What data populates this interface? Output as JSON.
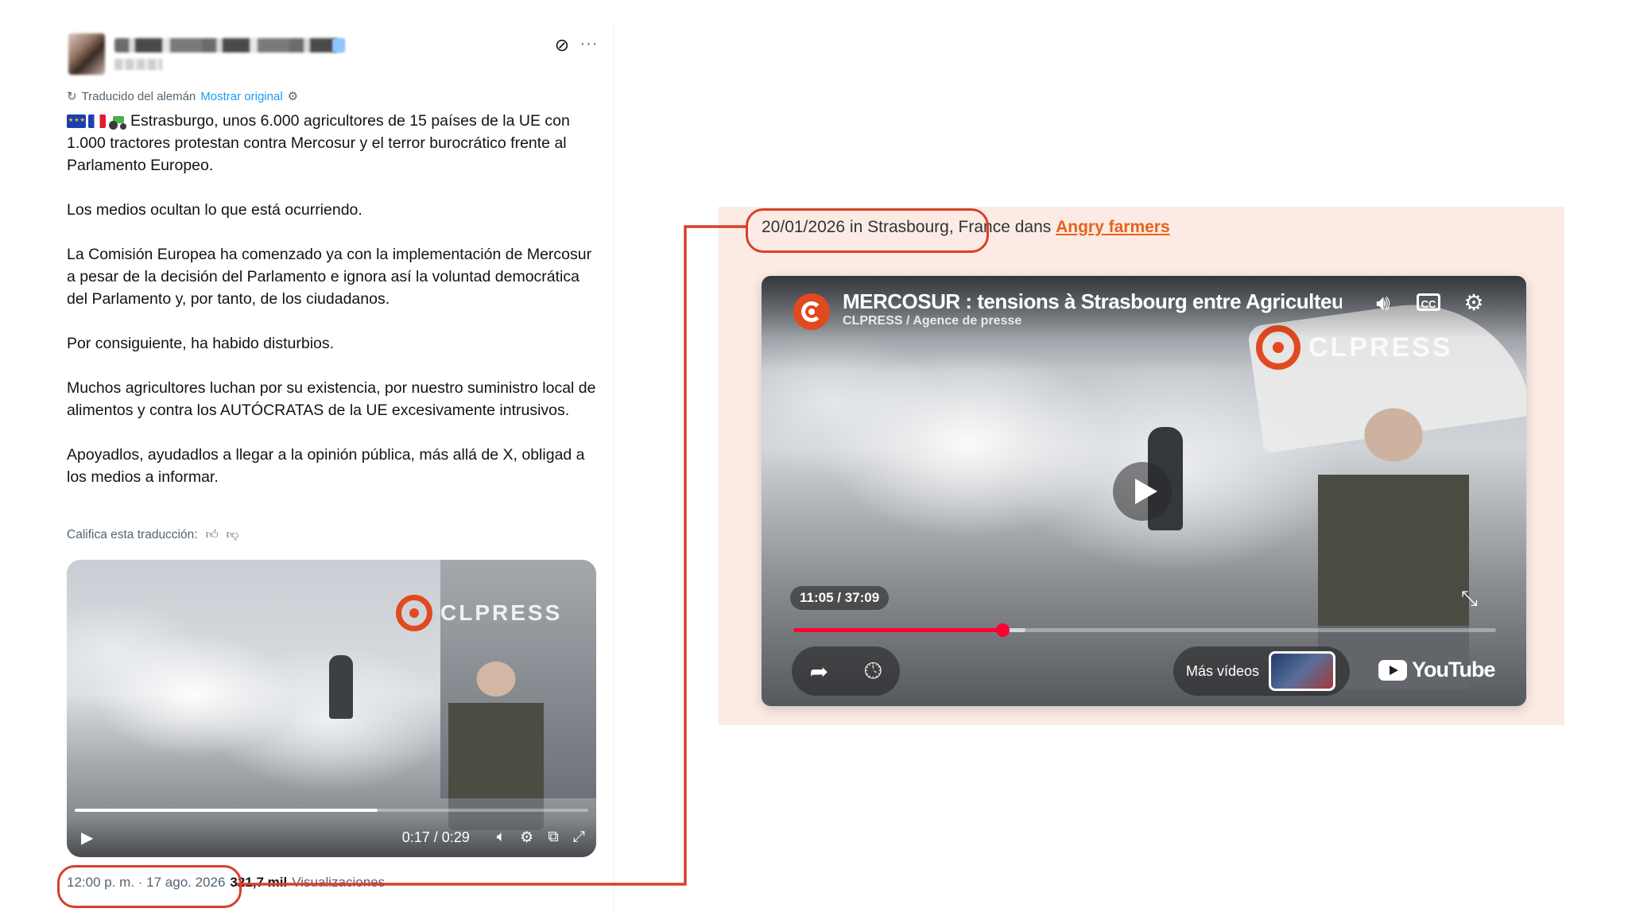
{
  "tweet": {
    "translated_label": "Traducido del alemán",
    "show_original_label": "Mostrar original",
    "paragraphs": [
      "Estrasburgo, unos 6.000 agricultores de 15 países de la UE con 1.000 tractores protestan contra Mercosur y el terror burocrático frente al Parlamento Europeo.",
      "Los medios ocultan lo que está ocurriendo.",
      "La Comisión Europea ha comenzado ya con la implementación de Mercosur a pesar de la decisión del Parlamento e ignora así la voluntad democrática del Parlamento y, por tanto, de los ciudadanos.",
      "Por consiguiente, ha habido disturbios.",
      "Muchos agricultores luchan por su existencia, por nuestro suministro local de alimentos y contra los AUTÓCRATAS de la UE excesivamente intrusivos.",
      "Apoyadlos, ayudadlos a llegar a la opinión pública, más allá de X, obligad a los medios a informar."
    ],
    "rate_label": "Califica esta traducción:",
    "video": {
      "watermark": "CLPRESS",
      "time": "0:17 / 0:29",
      "progress": 0.59
    },
    "timestamp": "12:00 p. m. · 17 ago. 2026",
    "views_count": "321,7 mil",
    "views_label": "Visualizaciones"
  },
  "icons": {
    "grok": "grok-icon",
    "more": "more-icon",
    "translate": "translate-icon",
    "settings": "gear-icon"
  },
  "article": {
    "date_location": "20/01/2026 in Strasbourg,",
    "location_rest": " France dans ",
    "tag": "Angry farmers",
    "video": {
      "title": "MERCOSUR : tensions à Strasbourg entre Agriculteurs",
      "subtitle": "CLPRESS / Agence de presse",
      "watermark": "CLPRESS",
      "time": "11:05 / 37:09",
      "progress": 0.298,
      "buffered": 0.33,
      "more_videos_label": "Más vídeos",
      "brand": "YouTube"
    }
  },
  "colors": {
    "annotation": "#d6402b",
    "panel_bg": "#fcebe4",
    "tag": "#e8611a",
    "twitter_link": "#1d9bf0",
    "yt_red": "#ff0033"
  }
}
